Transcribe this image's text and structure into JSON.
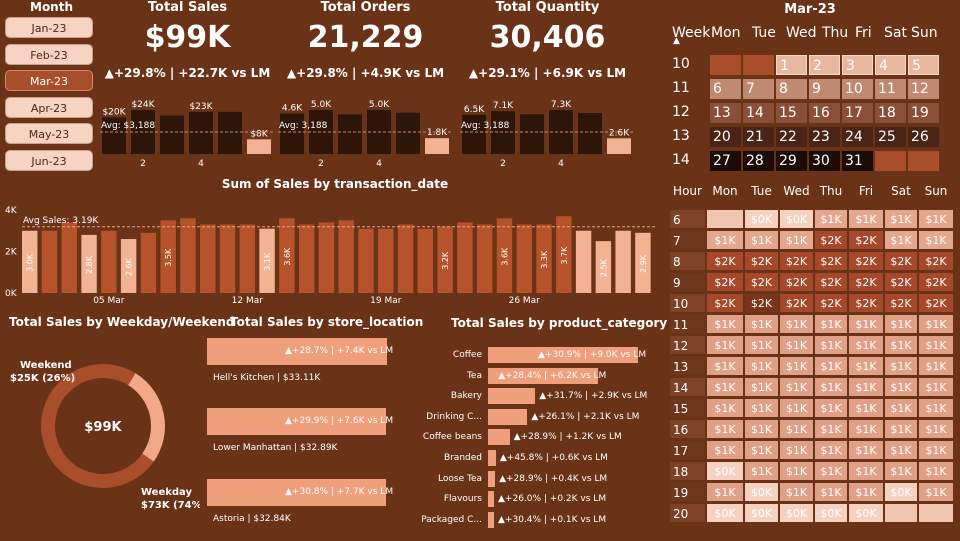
{
  "month_slicer": {
    "title": "Month",
    "items": [
      "Jan-23",
      "Feb-23",
      "Mar-23",
      "Apr-23",
      "May-23",
      "Jun-23"
    ],
    "selected": "Mar-23"
  },
  "kpis": [
    {
      "title": "Total Sales",
      "value": "$99K",
      "delta": "▲+29.8% | +22.7K vs LM",
      "bars": [
        20,
        24,
        21,
        23,
        23,
        8
      ],
      "labels": [
        "$20K",
        "$24K",
        "",
        "$23K",
        "",
        "$8K"
      ],
      "avg": "Avg: $3,188",
      "xticks": [
        "2",
        "4"
      ]
    },
    {
      "title": "Total Orders",
      "value": "21,229",
      "delta": "▲+29.8% | +4.9K vs LM",
      "bars": [
        4.6,
        5.0,
        4.5,
        5.0,
        4.7,
        1.8
      ],
      "labels": [
        "4.6K",
        "5.0K",
        "",
        "5.0K",
        "",
        "1.8K"
      ],
      "avg": "Avg: 3,188",
      "xticks": [
        "2",
        "4"
      ]
    },
    {
      "title": "Total Quantity",
      "value": "30,406",
      "delta": "▲+29.1% | +6.9K vs LM",
      "bars": [
        6.5,
        7.1,
        6.6,
        7.3,
        6.8,
        2.6
      ],
      "labels": [
        "6.5K",
        "7.1K",
        "",
        "7.3K",
        "",
        "2.6K"
      ],
      "avg": "Avg: 3,188",
      "xticks": [
        "2",
        "4"
      ]
    }
  ],
  "calendar": {
    "title": "Mar-23",
    "headers": [
      "Week",
      "Mon",
      "Tue",
      "Wed",
      "Thu",
      "Fri",
      "Sat",
      "Sun"
    ],
    "weeks": [
      {
        "week": "10",
        "days": [
          "",
          "",
          "1",
          "2",
          "3",
          "4",
          "5"
        ]
      },
      {
        "week": "11",
        "days": [
          "6",
          "7",
          "8",
          "9",
          "10",
          "11",
          "12"
        ]
      },
      {
        "week": "12",
        "days": [
          "13",
          "14",
          "15",
          "16",
          "17",
          "18",
          "19"
        ]
      },
      {
        "week": "13",
        "days": [
          "20",
          "21",
          "22",
          "23",
          "24",
          "25",
          "26"
        ]
      },
      {
        "week": "14",
        "days": [
          "27",
          "28",
          "29",
          "30",
          "31",
          "",
          ""
        ]
      }
    ]
  },
  "daily_chart": {
    "title": "Sum of Sales by transaction_date",
    "avg_label": "Avg Sales: 3.19K"
  },
  "chart_data": [
    {
      "type": "bar",
      "title": "Sum of Sales by transaction_date",
      "yticks": [
        "4K",
        "2K",
        "0K"
      ],
      "ylim": [
        0,
        4
      ],
      "xticks": [
        "05 Mar",
        "12 Mar",
        "19 Mar",
        "26 Mar"
      ],
      "values": [
        3.0,
        3.0,
        3.4,
        2.8,
        3.0,
        2.6,
        2.9,
        3.5,
        3.6,
        3.3,
        3.3,
        3.3,
        3.1,
        3.6,
        3.3,
        3.4,
        3.5,
        3.1,
        3.1,
        3.3,
        3.1,
        3.2,
        3.4,
        3.3,
        3.6,
        3.3,
        3.3,
        3.7,
        3.0,
        2.5,
        3.0,
        2.9
      ],
      "data_labels": [
        "3.0K",
        "",
        "",
        "2.8K",
        "",
        "2.6K",
        "",
        "3.5K",
        "",
        "",
        "",
        "",
        "3.1K",
        "3.6K",
        "",
        "",
        "",
        "",
        "",
        "",
        "",
        "3.2K",
        "",
        "",
        "3.6K",
        "",
        "3.3K",
        "3.7K",
        "",
        "2.5K",
        "",
        "2.9K"
      ],
      "avg": 3.19
    },
    {
      "type": "pie",
      "title": "Total Sales by Weekday/Weekend",
      "center": "$99K",
      "slices": [
        {
          "name": "Weekend",
          "label": "$25K (26%)",
          "value": 26
        },
        {
          "name": "Weekday",
          "label": "$73K (74%)",
          "value": 74
        }
      ]
    },
    {
      "type": "bar",
      "title": "Total Sales by store_location",
      "items": [
        {
          "name": "Hell's Kitchen | $33.11K",
          "delta": "▲+28.7% | +7.4K vs LM",
          "value": 33.11
        },
        {
          "name": "Lower Manhattan | $32.89K",
          "delta": "▲+29.9% | +7.6K vs LM",
          "value": 32.89
        },
        {
          "name": "Astoria | $32.84K",
          "delta": "▲+30.8% | +7.7K vs LM",
          "value": 32.84
        }
      ]
    },
    {
      "type": "bar",
      "title": "Total Sales by product_category",
      "items": [
        {
          "name": "Coffee",
          "delta": "▲+30.9% | +9.0K vs LM",
          "value": 38.1
        },
        {
          "name": "Tea",
          "delta": "▲+28.4% | +6.2K vs LM",
          "value": 28.0
        },
        {
          "name": "Bakery",
          "delta": "▲+31.7% | +2.9K vs LM",
          "value": 12.0
        },
        {
          "name": "Drinking C...",
          "delta": "▲+26.1% | +2.1K vs LM",
          "value": 10.0
        },
        {
          "name": "Coffee beans",
          "delta": "▲+28.9% | +1.2K vs LM",
          "value": 5.5
        },
        {
          "name": "Branded",
          "delta": "▲+45.8% | +0.6K vs LM",
          "value": 2.0
        },
        {
          "name": "Loose Tea",
          "delta": "▲+28.9% | +0.4K vs LM",
          "value": 1.8
        },
        {
          "name": "Flavours",
          "delta": "▲+26.0% | +0.2K vs LM",
          "value": 1.2
        },
        {
          "name": "Packaged C...",
          "delta": "▲+30.4% | +0.1K vs LM",
          "value": 0.6
        }
      ]
    }
  ],
  "heatmap": {
    "headers": [
      "Hour",
      "Mon",
      "Tue",
      "Wed",
      "Thu",
      "Fri",
      "Sat",
      "Sun"
    ],
    "rows": [
      {
        "hour": "6",
        "cells": [
          "",
          "$0K",
          "$0K",
          "$1K",
          "$1K",
          "$1K",
          "$1K"
        ]
      },
      {
        "hour": "7",
        "cells": [
          "$1K",
          "$1K",
          "$1K",
          "$2K",
          "$2K",
          "$1K",
          "$1K"
        ]
      },
      {
        "hour": "8",
        "cells": [
          "$2K",
          "$2K",
          "$2K",
          "$2K",
          "$2K",
          "$2K",
          "$2K"
        ]
      },
      {
        "hour": "9",
        "cells": [
          "$2K",
          "$2K",
          "$2K",
          "$2K",
          "$2K",
          "$2K",
          "$2K"
        ]
      },
      {
        "hour": "10",
        "cells": [
          "$2K",
          "$2K",
          "$2K",
          "$2K",
          "$2K",
          "$2K",
          "$2K"
        ]
      },
      {
        "hour": "11",
        "cells": [
          "$1K",
          "$1K",
          "$1K",
          "$1K",
          "$1K",
          "$1K",
          "$1K"
        ]
      },
      {
        "hour": "12",
        "cells": [
          "$1K",
          "$1K",
          "$1K",
          "$1K",
          "$1K",
          "$1K",
          "$1K"
        ]
      },
      {
        "hour": "13",
        "cells": [
          "$1K",
          "$1K",
          "$1K",
          "$1K",
          "$1K",
          "$1K",
          "$1K"
        ]
      },
      {
        "hour": "14",
        "cells": [
          "$1K",
          "$1K",
          "$1K",
          "$1K",
          "$1K",
          "$1K",
          "$1K"
        ]
      },
      {
        "hour": "15",
        "cells": [
          "$1K",
          "$1K",
          "$1K",
          "$1K",
          "$1K",
          "$1K",
          "$1K"
        ]
      },
      {
        "hour": "16",
        "cells": [
          "$1K",
          "$1K",
          "$1K",
          "$1K",
          "$1K",
          "$1K",
          "$1K"
        ]
      },
      {
        "hour": "17",
        "cells": [
          "$1K",
          "$1K",
          "$1K",
          "$1K",
          "$1K",
          "$1K",
          "$1K"
        ]
      },
      {
        "hour": "18",
        "cells": [
          "$0K",
          "$1K",
          "$1K",
          "$1K",
          "$1K",
          "$1K",
          "$1K"
        ]
      },
      {
        "hour": "19",
        "cells": [
          "$1K",
          "$0K",
          "$1K",
          "$1K",
          "$1K",
          "$0K",
          "$1K"
        ]
      },
      {
        "hour": "20",
        "cells": [
          "$0K",
          "$0K",
          "$0K",
          "$0K",
          "$0K",
          "",
          ""
        ]
      }
    ]
  }
}
